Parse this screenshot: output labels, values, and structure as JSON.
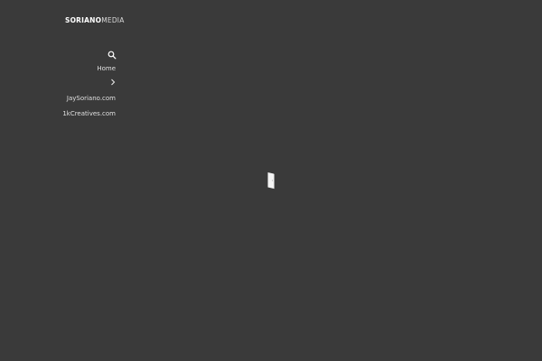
{
  "header": {
    "logo_bold": "SORIANO",
    "logo_light": "MEDIA"
  },
  "search": {
    "icon": "search-icon"
  },
  "nav": {
    "items": [
      {
        "label": "Home",
        "icon": "chevron-right-icon"
      },
      {
        "label": "JaySoriano.com"
      },
      {
        "label": "1kCreatives.com"
      }
    ]
  },
  "loader": {
    "icon": "loading-door-icon"
  },
  "colors": {
    "background": "#3a3a3a",
    "text": "#e6e6e6"
  }
}
